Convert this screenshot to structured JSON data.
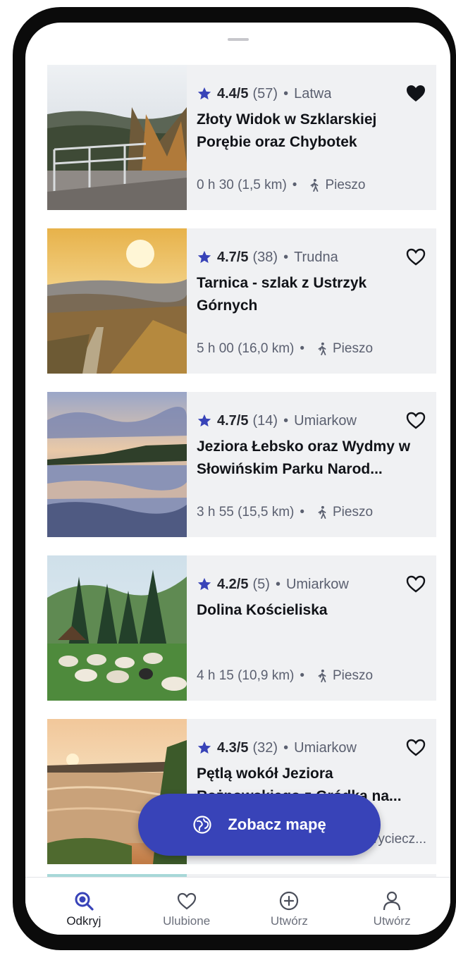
{
  "colors": {
    "accent": "#3843b8",
    "card_bg": "#f0f1f3",
    "text": "#111318",
    "muted": "#5b6070"
  },
  "routes": [
    {
      "rating": "4.4/5",
      "count": "(57)",
      "difficulty": "Latwa",
      "title": "Złoty Widok w Szklarskiej Porębie oraz Chybotek",
      "summary": "0 h 30 (1,5 km)",
      "mode": "Pieszo",
      "favorite": true
    },
    {
      "rating": "4.7/5",
      "count": "(38)",
      "difficulty": "Trudna",
      "title": "Tarnica - szlak z Ustrzyk Górnych",
      "summary": "5 h 00 (16,0 km)",
      "mode": "Pieszo",
      "favorite": false
    },
    {
      "rating": "4.7/5",
      "count": "(14)",
      "difficulty": "Umiarkow",
      "title": "Jeziora Łebsko oraz Wydmy w Słowińskim Parku Narod...",
      "summary": "3 h 55 (15,5 km)",
      "mode": "Pieszo",
      "favorite": false
    },
    {
      "rating": "4.2/5",
      "count": "(5)",
      "difficulty": "Umiarkow",
      "title": "Dolina Kościeliska",
      "summary": "4 h 15 (10,9 km)",
      "mode": "Pieszo",
      "favorite": false
    },
    {
      "rating": "4.3/5",
      "count": "(32)",
      "difficulty": "Umiarkow",
      "title": "Pętlą wokół Jeziora Rożnowskiego z Gródka na...",
      "summary": "",
      "mode": "Wyciecz...",
      "favorite": false
    }
  ],
  "fab": {
    "label": "Zobacz mapę",
    "icon": "map-icon"
  },
  "nav": [
    {
      "label": "Odkryj",
      "icon": "search-icon",
      "active": true
    },
    {
      "label": "Ulubione",
      "icon": "heart-icon",
      "active": false
    },
    {
      "label": "Utwórz",
      "icon": "plus-circle-icon",
      "active": false
    },
    {
      "label": "Utwórz",
      "icon": "profile-icon",
      "active": false
    }
  ]
}
